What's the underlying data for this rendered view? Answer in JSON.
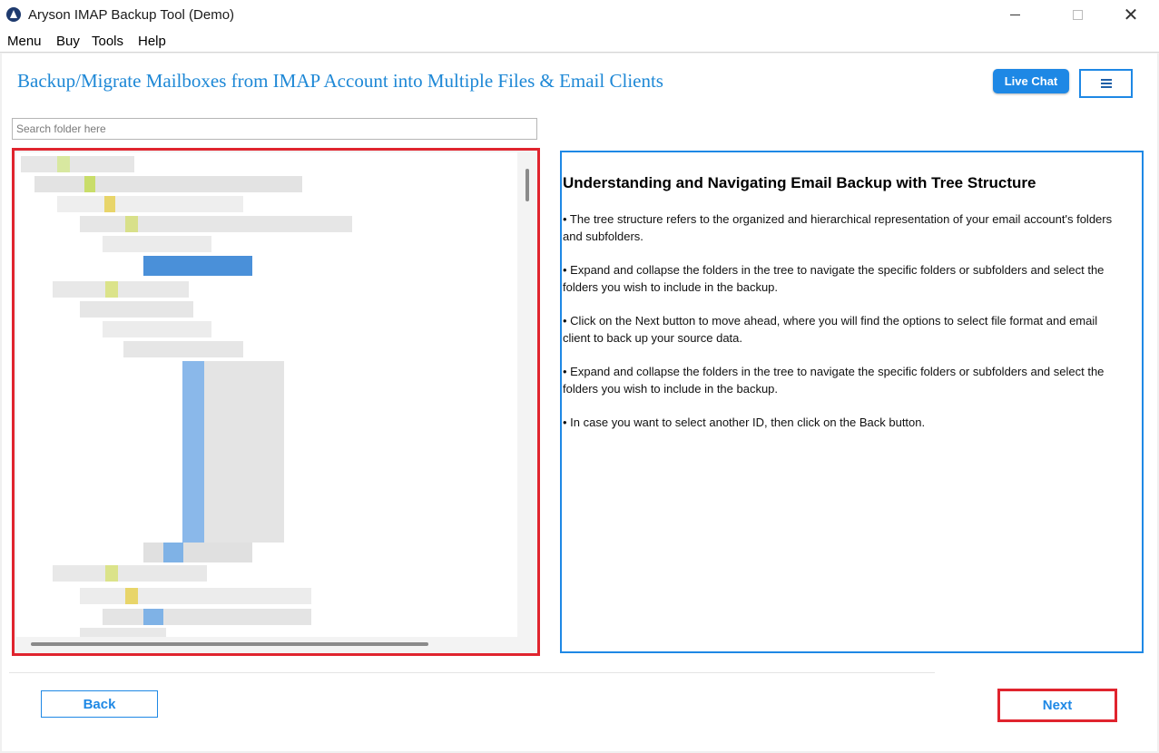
{
  "window": {
    "title": "Aryson IMAP Backup Tool (Demo)",
    "minimize_icon": "minimize-icon",
    "maximize_icon": "maximize-icon",
    "close_symbol": "✕"
  },
  "menubar": {
    "items": [
      "Menu",
      "Buy",
      "Tools",
      "Help"
    ]
  },
  "header": {
    "title": "Backup/Migrate Mailboxes from IMAP Account into Multiple Files & Email Clients",
    "live_chat_label": "Live Chat",
    "hamburger_icon": "hamburger-menu-icon"
  },
  "search": {
    "placeholder": "Search folder here",
    "value": ""
  },
  "info": {
    "title": "Understanding and Navigating Email Backup with Tree Structure",
    "bullets": [
      "•  The tree structure refers to the organized and hierarchical representation of your email account's folders and subfolders.",
      "•  Expand and collapse the folders in the tree to navigate the specific folders or subfolders and select the folders you wish to include in the backup.",
      "•  Click on the Next button to move ahead, where you will find the options to select file format and email client to back up your source data.",
      "•  Expand and collapse the folders in the tree to navigate the specific folders or subfolders and select the folders you wish to include in the backup.",
      "•  In case you want to select another ID, then click on the Back button."
    ]
  },
  "footer": {
    "back_label": "Back",
    "next_label": "Next"
  },
  "colors": {
    "accent": "#1e88e5",
    "highlight_border": "#e0242e"
  }
}
